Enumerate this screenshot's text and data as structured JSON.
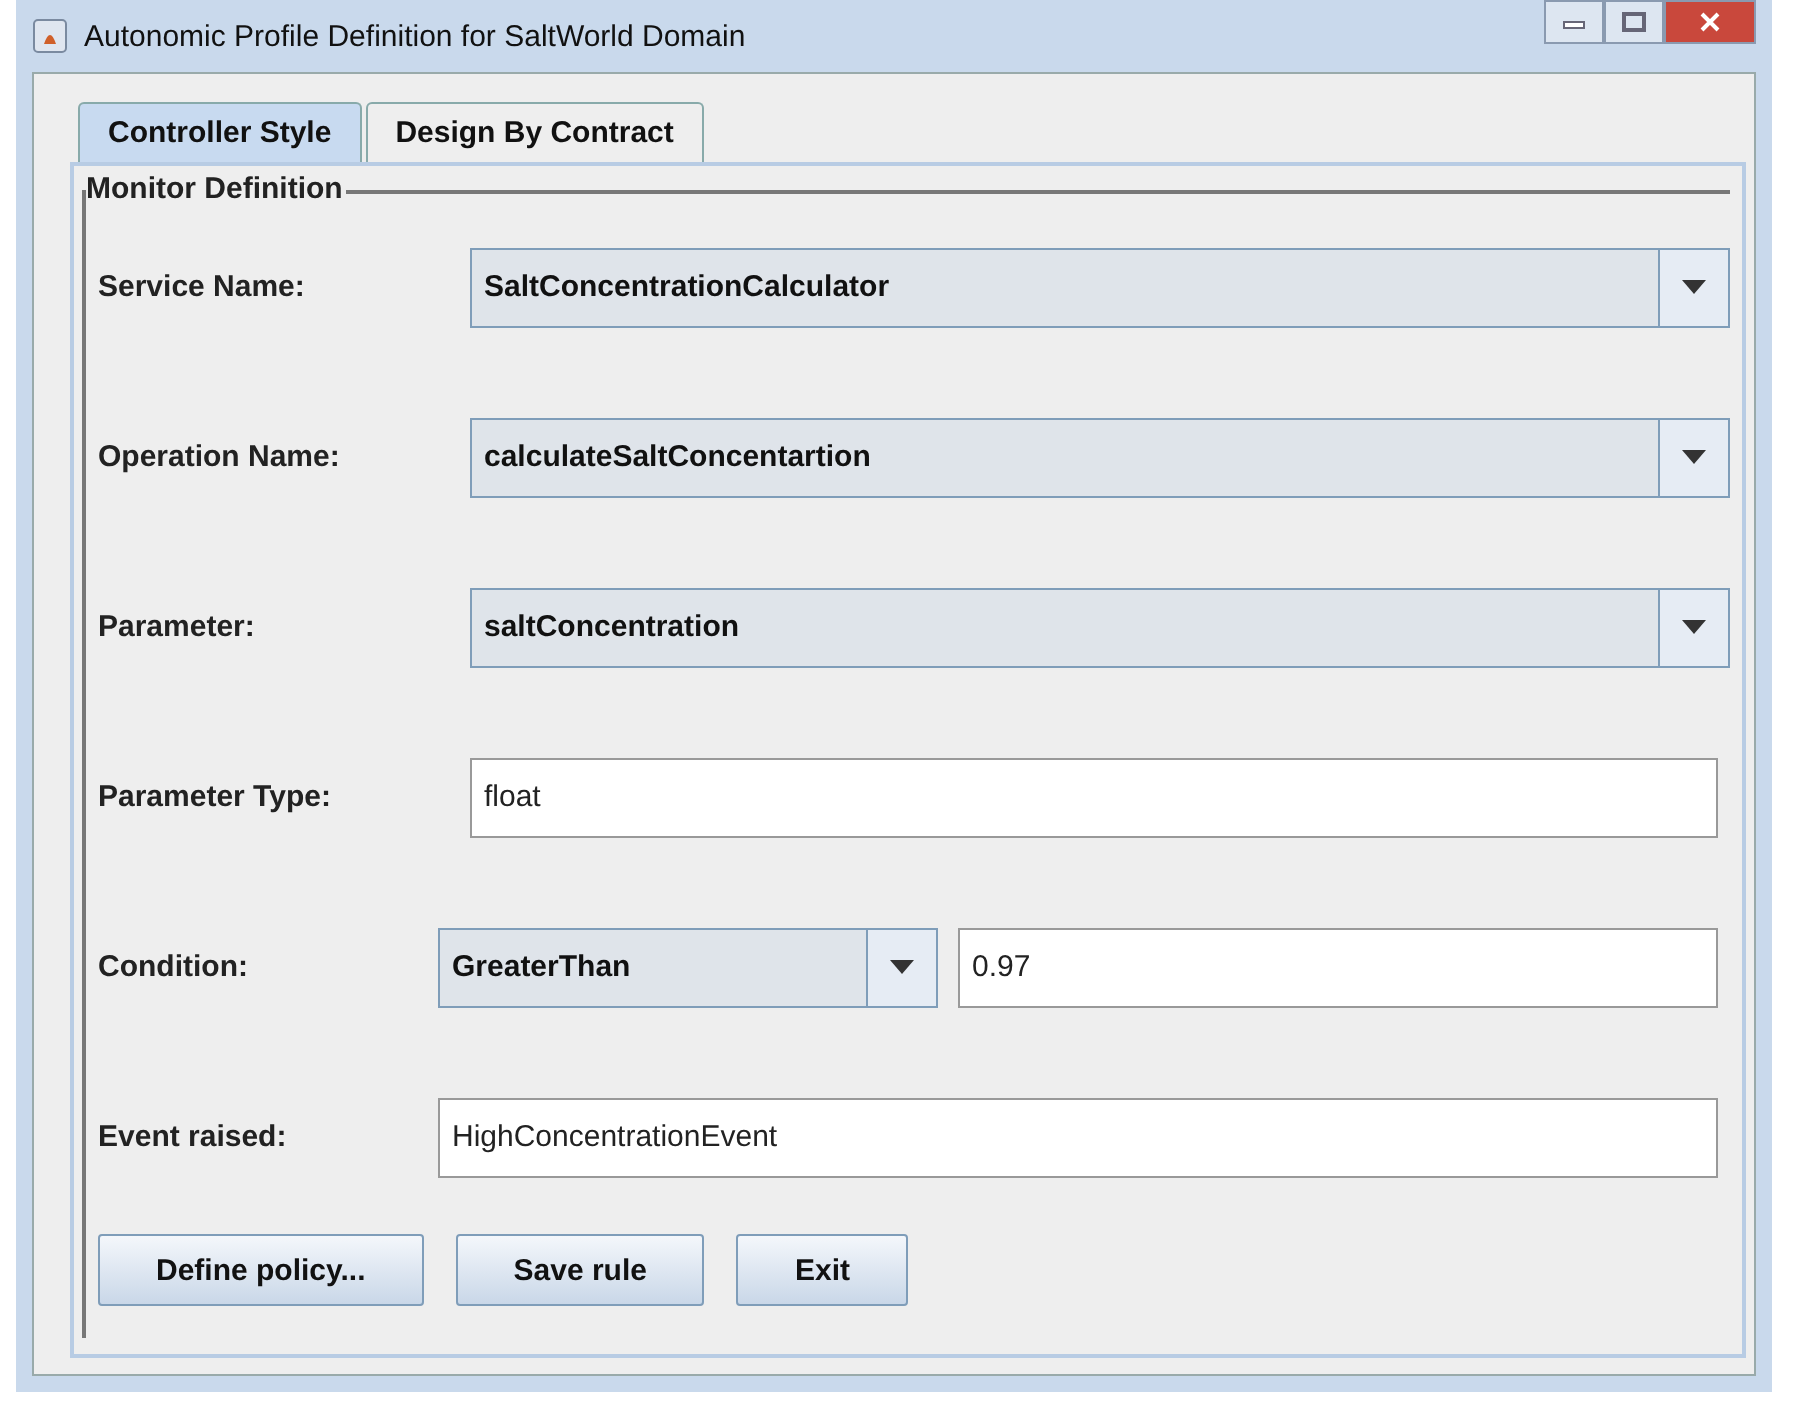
{
  "window": {
    "title": "Autonomic Profile Definition for SaltWorld Domain"
  },
  "tabs": [
    {
      "label": "Controller Style",
      "selected": true
    },
    {
      "label": "Design By Contract",
      "selected": false
    }
  ],
  "group": {
    "title": "Monitor Definition"
  },
  "rows": [
    {
      "kind": "combo",
      "label": "Service Name:",
      "value": "SaltConcentrationCalculator"
    },
    {
      "kind": "combo",
      "label": "Operation Name:",
      "value": "calculateSaltConcentartion"
    },
    {
      "kind": "combo",
      "label": "Parameter:",
      "value": "saltConcentration"
    },
    {
      "kind": "text",
      "label": "Parameter Type:",
      "value": "float"
    },
    {
      "kind": "condition",
      "label": "Condition:",
      "value": "GreaterThan",
      "operand": "0.97"
    },
    {
      "kind": "event",
      "label": "Event raised:",
      "value": "HighConcentrationEvent"
    }
  ],
  "buttons": [
    "Define policy...",
    "Save rule",
    "Exit"
  ]
}
